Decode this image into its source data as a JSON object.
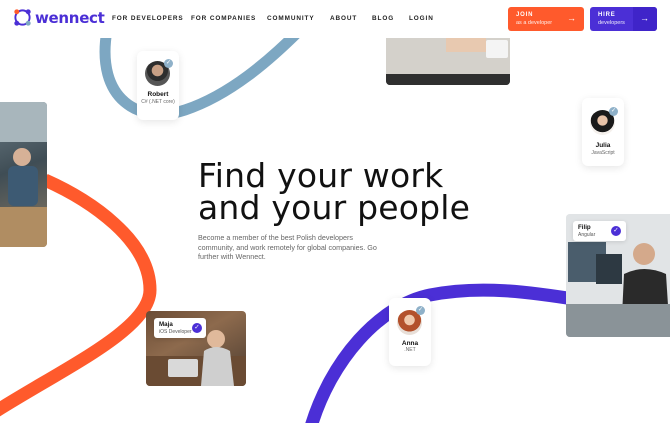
{
  "brand": {
    "name": "wennect",
    "primary_color": "#4b2fd6",
    "accent_color": "#ff5a2c",
    "steel_color": "#7da7c2"
  },
  "nav": {
    "items": [
      {
        "label": "FOR DEVELOPERS"
      },
      {
        "label": "FOR COMPANIES"
      },
      {
        "label": "COMMUNITY"
      },
      {
        "label": "ABOUT"
      },
      {
        "label": "BLOG"
      },
      {
        "label": "LOGIN"
      }
    ]
  },
  "cta": {
    "join": {
      "label": "JOIN",
      "sub": "as a developer",
      "icon": "arrow-right-icon"
    },
    "hire": {
      "label": "HIRE",
      "sub": "developers",
      "icon": "arrow-right-icon"
    }
  },
  "hero": {
    "title_line1": "Find your work",
    "title_line2": "and your people",
    "subtitle": "Become a member of the best Polish developers community, and work remotely for global companies. Go further with Wennect."
  },
  "profiles": {
    "robert": {
      "name": "Robert",
      "role": "C# (.NET core)"
    },
    "julia": {
      "name": "Julia",
      "role": "JavaScript"
    },
    "anna": {
      "name": "Anna",
      "role": ".NET"
    },
    "maja": {
      "name": "Maja",
      "role": "iOS Developer"
    },
    "filip": {
      "name": "Filip",
      "role": "Angular"
    }
  }
}
